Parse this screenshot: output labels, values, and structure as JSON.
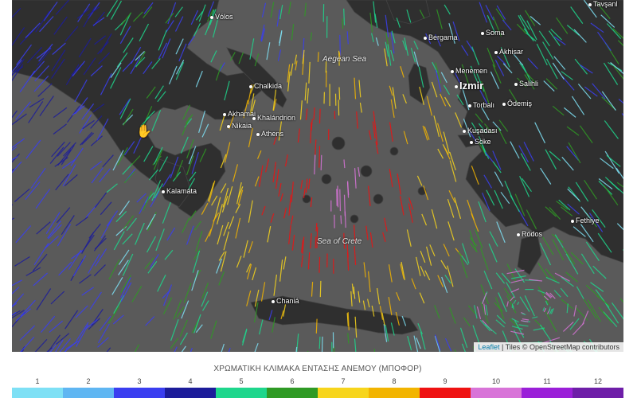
{
  "map": {
    "sea_labels": {
      "aegean": "Aegean Sea",
      "crete": "Sea of Crete"
    },
    "cities": [
      {
        "id": "volos",
        "name": "Vólos"
      },
      {
        "id": "tavsan",
        "name": "Tavşanl"
      },
      {
        "id": "soma",
        "name": "Soma"
      },
      {
        "id": "bergama",
        "name": "Bergama"
      },
      {
        "id": "akhisar",
        "name": "Akhisar"
      },
      {
        "id": "menemen",
        "name": "Menemen"
      },
      {
        "id": "izmir",
        "name": "Izmir"
      },
      {
        "id": "salihli",
        "name": "Salihli"
      },
      {
        "id": "chalkida",
        "name": "Chalkida"
      },
      {
        "id": "torbali",
        "name": "Torbalı"
      },
      {
        "id": "odemis",
        "name": "Ödemiş"
      },
      {
        "id": "akhamai",
        "name": "Akhamai"
      },
      {
        "id": "khalandrion",
        "name": "Khalándrion"
      },
      {
        "id": "nikaia",
        "name": "Nikaia"
      },
      {
        "id": "athens",
        "name": "Athens"
      },
      {
        "id": "kusadasi",
        "name": "Kuşadası"
      },
      {
        "id": "soke",
        "name": "Söke"
      },
      {
        "id": "kalamata",
        "name": "Kalamáta"
      },
      {
        "id": "fethiye",
        "name": "Fethiye"
      },
      {
        "id": "rodos",
        "name": "Ródos"
      },
      {
        "id": "chania",
        "name": "Chaniá"
      }
    ],
    "attribution": {
      "leaflet": "Leaflet",
      "separator": " | ",
      "tiles": "Tiles © OpenStreetMap contributors"
    }
  },
  "legend": {
    "title": "ΧΡΩΜΑΤΙΚΗ ΚΛΙΜΑΚΑ ΕΝΤΑΣΗΣ ΑΝΕΜΟΥ (ΜΠΟΦΟΡ)",
    "levels": [
      {
        "label": "1",
        "color": "#7ee0f5"
      },
      {
        "label": "2",
        "color": "#5fb6f2"
      },
      {
        "label": "3",
        "color": "#3a3ef0"
      },
      {
        "label": "4",
        "color": "#1c1c9a"
      },
      {
        "label": "5",
        "color": "#1ed68c"
      },
      {
        "label": "6",
        "color": "#2f9a25"
      },
      {
        "label": "7",
        "color": "#f7d51c"
      },
      {
        "label": "8",
        "color": "#f2b400"
      },
      {
        "label": "9",
        "color": "#ef1212"
      },
      {
        "label": "10",
        "color": "#d874d8"
      },
      {
        "label": "11",
        "color": "#9a1fd8"
      },
      {
        "label": "12",
        "color": "#6e1ea8"
      }
    ]
  },
  "colors": {
    "sea": "#5a5a5a",
    "land": "#2e2e2e"
  }
}
